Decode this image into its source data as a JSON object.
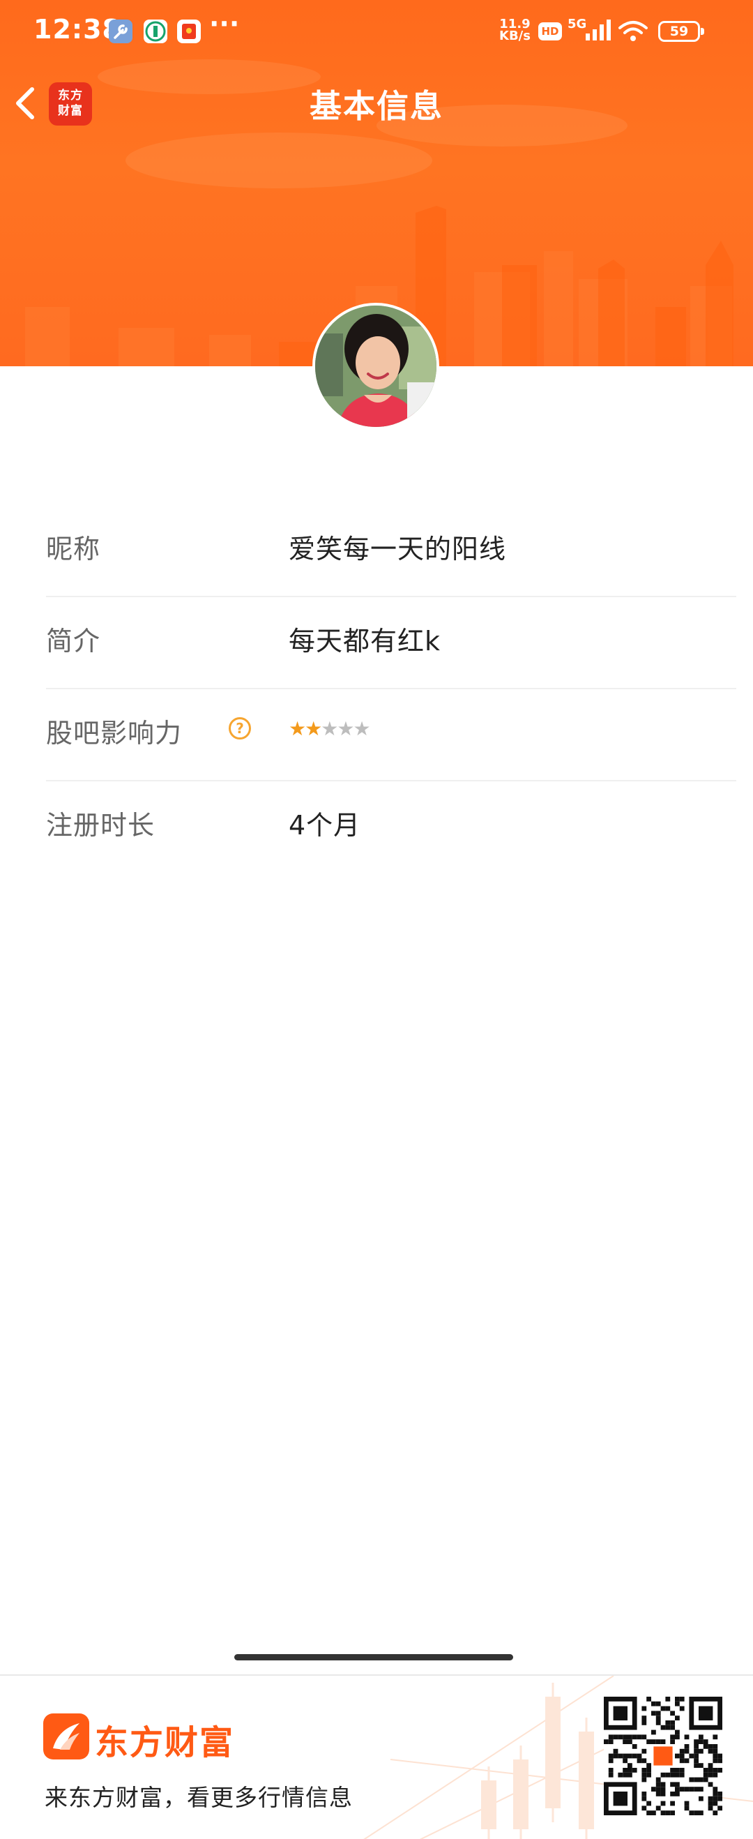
{
  "status_bar": {
    "time": "12:38",
    "net_speed_top": "11.9",
    "net_speed_bottom": "KB/s",
    "hd": "HD",
    "network": "5G",
    "battery": "59",
    "more": "···"
  },
  "nav": {
    "title": "基本信息",
    "brand_line1": "东方",
    "brand_line2": "财富"
  },
  "colors": {
    "header_orange": "#ff6a1c",
    "star_on": "#f39a1c",
    "star_off": "#bdbdbd",
    "brand_red": "#ff5a14"
  },
  "profile": {
    "rows": [
      {
        "label": "昵称",
        "value": "爱笑每一天的阳线"
      },
      {
        "label": "简介",
        "value": "每天都有红k"
      },
      {
        "label": "股吧影响力",
        "help": "?",
        "rating": 2,
        "rating_max": 5
      },
      {
        "label": "注册时长",
        "value": "4个月"
      }
    ]
  },
  "footer": {
    "brand": "东方财富",
    "slogan": "来东方财富，看更多行情信息"
  }
}
